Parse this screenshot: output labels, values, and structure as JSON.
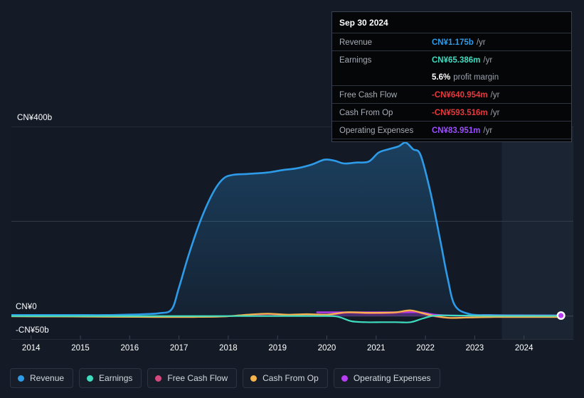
{
  "chart_data": {
    "type": "area",
    "title": "",
    "xlabel": "",
    "ylabel": "",
    "currency": "CN¥",
    "xlim": [
      2013.6,
      2025.0
    ],
    "ylim": [
      -50,
      400
    ],
    "ylim_units": "billions CN¥",
    "grid": true,
    "legend_position": "bottom-left",
    "y_ticks": [
      {
        "value": 400,
        "label": "CN¥400b"
      },
      {
        "value": 200,
        "label": ""
      },
      {
        "value": 0,
        "label": "CN¥0"
      },
      {
        "value": -50,
        "label": "-CN¥50b"
      }
    ],
    "x_ticks": [
      {
        "value": 2014,
        "label": "2014"
      },
      {
        "value": 2015,
        "label": "2015"
      },
      {
        "value": 2016,
        "label": "2016"
      },
      {
        "value": 2017,
        "label": "2017"
      },
      {
        "value": 2018,
        "label": "2018"
      },
      {
        "value": 2019,
        "label": "2019"
      },
      {
        "value": 2020,
        "label": "2020"
      },
      {
        "value": 2021,
        "label": "2021"
      },
      {
        "value": 2022,
        "label": "2022"
      },
      {
        "value": 2023,
        "label": "2023"
      },
      {
        "value": 2024,
        "label": "2024"
      }
    ],
    "forecast_band_start": 2023.55,
    "series": [
      {
        "name": "Revenue",
        "color": "#2e9be8",
        "filled": true,
        "x": [
          2013.6,
          2014.0,
          2014.5,
          2015.0,
          2015.5,
          2016.0,
          2016.3,
          2016.6,
          2016.85,
          2017.0,
          2017.2,
          2017.45,
          2017.7,
          2017.9,
          2018.1,
          2018.4,
          2018.8,
          2019.1,
          2019.4,
          2019.7,
          2019.95,
          2020.15,
          2020.35,
          2020.6,
          2020.85,
          2021.05,
          2021.25,
          2021.45,
          2021.6,
          2021.75,
          2021.9,
          2022.1,
          2022.3,
          2022.45,
          2022.6,
          2022.9,
          2023.3,
          2023.8,
          2024.3,
          2024.75
        ],
        "y": [
          2,
          2,
          2,
          2,
          2,
          3,
          4,
          6,
          14,
          60,
          130,
          205,
          262,
          290,
          298,
          300,
          303,
          308,
          312,
          320,
          330,
          328,
          322,
          324,
          326,
          345,
          352,
          358,
          366,
          352,
          340,
          262,
          160,
          80,
          22,
          4,
          2,
          1.5,
          1.3,
          1.2
        ]
      },
      {
        "name": "Earnings",
        "color": "#3fddc0",
        "filled": false,
        "x": [
          2013.6,
          2014.5,
          2015.5,
          2016.5,
          2017.2,
          2017.8,
          2018.3,
          2018.8,
          2019.3,
          2019.8,
          2020.2,
          2020.5,
          2020.8,
          2021.1,
          2021.4,
          2021.7,
          2021.95,
          2022.2,
          2022.6,
          2023.2,
          2023.9,
          2024.75
        ],
        "y": [
          0,
          0,
          0,
          0,
          0,
          0,
          0,
          0,
          0,
          0,
          -1,
          -11,
          -13,
          -13,
          -13,
          -13,
          -5,
          1,
          1,
          0.5,
          0.4,
          0.4
        ]
      },
      {
        "name": "Free Cash Flow",
        "color": "#d6487e",
        "filled": false,
        "x": [
          2013.6,
          2014.5,
          2015.5,
          2016.5,
          2017.3,
          2017.9,
          2018.4,
          2018.8,
          2019.2,
          2019.6,
          2020.0,
          2020.4,
          2020.8,
          2021.1,
          2021.4,
          2021.7,
          2021.95,
          2022.2,
          2022.5,
          2022.9,
          2023.4,
          2024.0,
          2024.75
        ],
        "y": [
          -0.5,
          -1,
          -1.5,
          -2,
          -2,
          -1,
          2,
          4,
          2,
          3,
          2,
          7,
          6,
          6,
          7,
          11,
          5,
          -1,
          -4,
          -3,
          -2,
          -2,
          -2
        ]
      },
      {
        "name": "Cash From Op",
        "color": "#f5b44c",
        "filled": false,
        "x": [
          2013.6,
          2014.5,
          2015.5,
          2016.5,
          2017.3,
          2017.9,
          2018.4,
          2018.8,
          2019.2,
          2019.6,
          2020.0,
          2020.4,
          2020.8,
          2021.1,
          2021.4,
          2021.7,
          2021.95,
          2022.2,
          2022.5,
          2022.9,
          2023.4,
          2024.0,
          2024.75
        ],
        "y": [
          -0.5,
          -1,
          -1.5,
          -2,
          -2,
          -1,
          3,
          5,
          3,
          4,
          3,
          8,
          7,
          7,
          8,
          12,
          6,
          0,
          -4,
          -3,
          -2,
          -2,
          -2
        ]
      },
      {
        "name": "Operating Expenses",
        "color": "#b83df5",
        "filled": true,
        "x": [
          2019.8,
          2020.2,
          2020.7,
          2021.2,
          2021.6,
          2021.9,
          2022.2,
          2022.6,
          2023.2,
          2023.9,
          2024.75
        ],
        "y": [
          8,
          8,
          8,
          8,
          8,
          8,
          3,
          1,
          1,
          1,
          1
        ]
      }
    ],
    "end_marker": {
      "series": "Operating Expenses",
      "x": 2024.75,
      "y": 1,
      "color": "#b83df5"
    }
  },
  "tooltip": {
    "date": "Sep 30 2024",
    "rows": [
      {
        "key": "Revenue",
        "value": "CN¥1.175b",
        "unit": "/yr",
        "color": "#2e9be8"
      },
      {
        "key": "Earnings",
        "value": "CN¥65.386m",
        "unit": "/yr",
        "color": "#3fddc0"
      },
      {
        "key": "",
        "value": "5.6%",
        "unit": "profit margin",
        "color": "#ffffff"
      },
      {
        "key": "Free Cash Flow",
        "value": "-CN¥640.954m",
        "unit": "/yr",
        "color": "#e8393c"
      },
      {
        "key": "Cash From Op",
        "value": "-CN¥593.516m",
        "unit": "/yr",
        "color": "#e8393c"
      },
      {
        "key": "Operating Expenses",
        "value": "CN¥83.951m",
        "unit": "/yr",
        "color": "#9b4dff"
      }
    ]
  },
  "legend": {
    "items": [
      {
        "label": "Revenue",
        "color": "#2e9be8"
      },
      {
        "label": "Earnings",
        "color": "#3fddc0"
      },
      {
        "label": "Free Cash Flow",
        "color": "#d6487e"
      },
      {
        "label": "Cash From Op",
        "color": "#f5b44c"
      },
      {
        "label": "Operating Expenses",
        "color": "#b83df5"
      }
    ]
  },
  "axes": {
    "y_top_label": "CN¥400b",
    "y_zero_label": "CN¥0",
    "y_bottom_label": "-CN¥50b"
  }
}
